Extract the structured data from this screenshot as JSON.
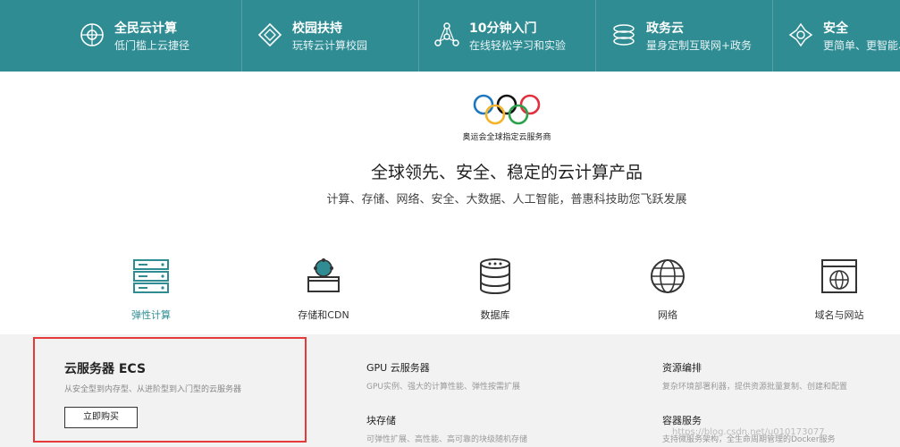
{
  "banner": {
    "items": [
      {
        "title": "全民云计算",
        "subtitle": "低门槛上云捷径",
        "icon": "cloud-globe-icon"
      },
      {
        "title": "校园扶持",
        "subtitle": "玩转云计算校园",
        "icon": "campus-icon"
      },
      {
        "title": "10分钟入门",
        "subtitle": "在线轻松学习和实验",
        "icon": "network-nodes-icon"
      },
      {
        "title": "政务云",
        "subtitle": "量身定制互联网+政务",
        "icon": "government-icon"
      },
      {
        "title": "安全",
        "subtitle": "更简单、更智能、",
        "icon": "security-icon"
      }
    ]
  },
  "hero": {
    "sponsor": "奥运会全球指定云服务商",
    "title": "全球领先、安全、稳定的云计算产品",
    "subtitle": "计算、存储、网络、安全、大数据、人工智能，普惠科技助您飞跃发展"
  },
  "categories": [
    {
      "label": "弹性计算",
      "icon": "server-icon",
      "active": true
    },
    {
      "label": "存储和CDN",
      "icon": "storage-icon",
      "active": false
    },
    {
      "label": "数据库",
      "icon": "database-icon",
      "active": false
    },
    {
      "label": "网络",
      "icon": "globe-icon",
      "active": false
    },
    {
      "label": "域名与网站",
      "icon": "website-icon",
      "active": false
    }
  ],
  "featured": {
    "title": "云服务器 ECS",
    "description": "从安全型到内存型、从进阶型到入门型的云服务器",
    "button": "立即购买"
  },
  "products": [
    {
      "title": "GPU 云服务器",
      "description": "GPU实例、强大的计算性能、弹性按需扩展"
    },
    {
      "title": "资源编排",
      "description": "复杂环境部署利器，提供资源批量复制、创建和配置"
    },
    {
      "title": "块存储",
      "description": "可弹性扩展、高性能、高可靠的块级随机存储"
    },
    {
      "title": "容器服务",
      "description": "支持微服务架构，全生命周期管理的Docker服务"
    }
  ],
  "watermark": "https://blog.csdn.net/u010173077",
  "colors": {
    "banner": "#2f8c93",
    "accent": "#2f8c93",
    "highlight": "#e63a3a",
    "panel": "#f2f2f2"
  }
}
